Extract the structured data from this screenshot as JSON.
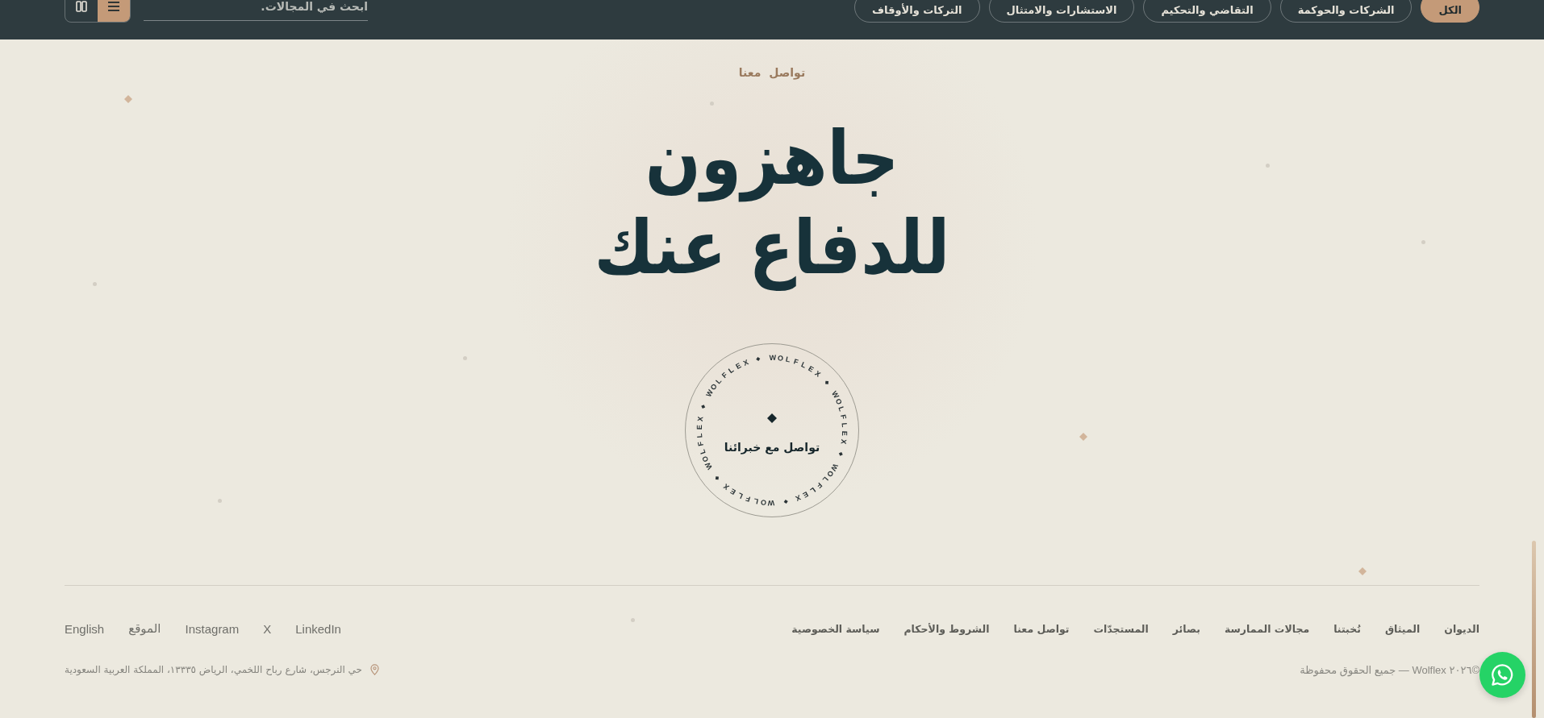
{
  "header": {
    "view_buttons": [
      {
        "kind": "columns",
        "selected": false
      },
      {
        "kind": "list",
        "selected": true
      }
    ],
    "search": {
      "placeholder": "ابحث في المجالات."
    },
    "filters": [
      {
        "label": "الكل",
        "selected": true
      },
      {
        "label": "الشركات والحوكمة",
        "selected": false
      },
      {
        "label": "التقاضي والتحكيم",
        "selected": false
      },
      {
        "label": "الاستشارات والامتثال",
        "selected": false
      },
      {
        "label": "التركات والأوقاف",
        "selected": false
      }
    ]
  },
  "hero": {
    "eyebrow": "تواصل معنا",
    "title": "جاهزون للدفاع عنك",
    "badge": {
      "ring_words": [
        "WOLFLEX",
        "WOLFLEX",
        "WOLFLEX",
        "WOLFLEX",
        "WOLFLEX",
        "WOLFLEX"
      ],
      "label": "تواصل مع خبرائنا"
    }
  },
  "footer": {
    "nav": [
      "الديوان",
      "الميثاق",
      "نُخبتنا",
      "مجالات الممارسة",
      "بصائر",
      "المستجدّات",
      "تواصل معنا",
      "الشروط والأحكام",
      "سياسة الخصوصية"
    ],
    "social": [
      "LinkedIn",
      "X",
      "Instagram",
      "الموقع",
      "English"
    ],
    "copyright": "©٢٠٢٦ Wolflex — جميع الحقوق محفوظة",
    "address": "حي النرجس، شارع رباح اللخمي، الرياض ١٣٣٣٥، المملكة العربية السعودية"
  }
}
